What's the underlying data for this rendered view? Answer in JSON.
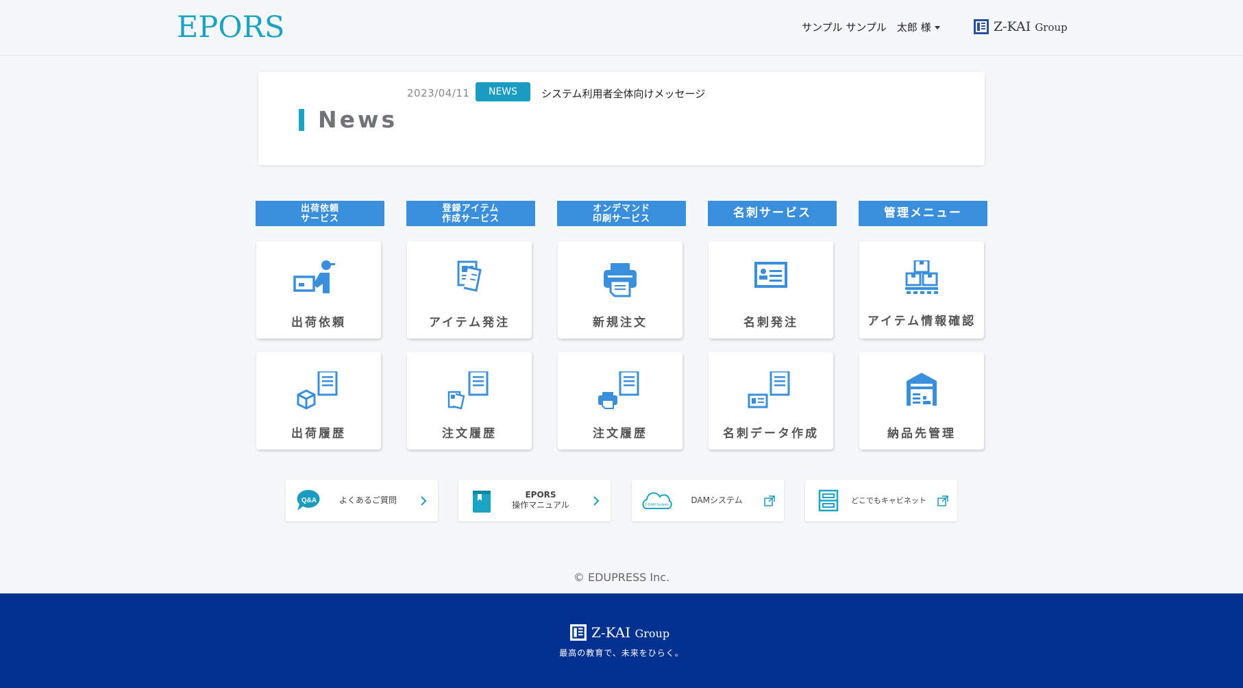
{
  "header": {
    "logo": "EPORS",
    "user_menu": "サンプル サンプル　太郎 様",
    "group_logo": "Z-KAI",
    "group_suffix": "Group"
  },
  "news": {
    "title": "News",
    "items": [
      {
        "date": "2023/04/11",
        "badge": "NEWS",
        "text": "システム利用者全体向けメッセージ"
      }
    ]
  },
  "columns": [
    {
      "header_line1": "出荷依頼",
      "header_line2": "サービス",
      "cards": [
        {
          "label": "出荷依頼",
          "icon": "delivery-person-icon"
        },
        {
          "label": "出荷履歴",
          "icon": "box-document-icon"
        }
      ]
    },
    {
      "header_line1": "登録アイテム",
      "header_line2": "作成サービス",
      "cards": [
        {
          "label": "アイテム発注",
          "icon": "documents-icon"
        },
        {
          "label": "注文履歴",
          "icon": "documents-history-icon"
        }
      ]
    },
    {
      "header_line1": "オンデマンド",
      "header_line2": "印刷サービス",
      "cards": [
        {
          "label": "新規注文",
          "icon": "printer-icon"
        },
        {
          "label": "注文履歴",
          "icon": "printer-history-icon"
        }
      ]
    },
    {
      "header_line1": "名刺サービス",
      "header_line2": "",
      "cards": [
        {
          "label": "名刺発注",
          "icon": "business-card-icon"
        },
        {
          "label": "名刺データ作成",
          "icon": "business-card-document-icon"
        }
      ]
    },
    {
      "header_line1": "管理メニュー",
      "header_line2": "",
      "cards": [
        {
          "label": "アイテム情報確認",
          "icon": "stacked-boxes-icon"
        },
        {
          "label": "納品先管理",
          "icon": "warehouse-icon"
        }
      ]
    }
  ],
  "quick_links": [
    {
      "line1": "よくあるご質問",
      "line2": "",
      "icon": "qa-bubble-icon",
      "action": "chevron-right-icon"
    },
    {
      "line1": "EPORS",
      "line2": "操作マニュアル",
      "icon": "manual-book-icon",
      "action": "chevron-right-icon"
    },
    {
      "line1": "DAMシステム",
      "line2": "",
      "icon": "dam-cloud-icon",
      "icon_text": "Z-DAM System",
      "action": "external-link-icon"
    },
    {
      "line1": "どこでもキャビネット",
      "line2": "",
      "icon": "cabinet-icon",
      "action": "external-link-icon"
    }
  ],
  "copyright": "© EDUPRESS Inc.",
  "footer": {
    "group_logo": "Z-KAI",
    "group_suffix": "Group",
    "slogan": "最高の教育で、未来をひらく。"
  },
  "colors": {
    "brand_teal": "#1aa3c2",
    "button_blue": "#3a8fdc",
    "icon_blue": "#3a8fdc",
    "footer_navy": "#03318f"
  }
}
